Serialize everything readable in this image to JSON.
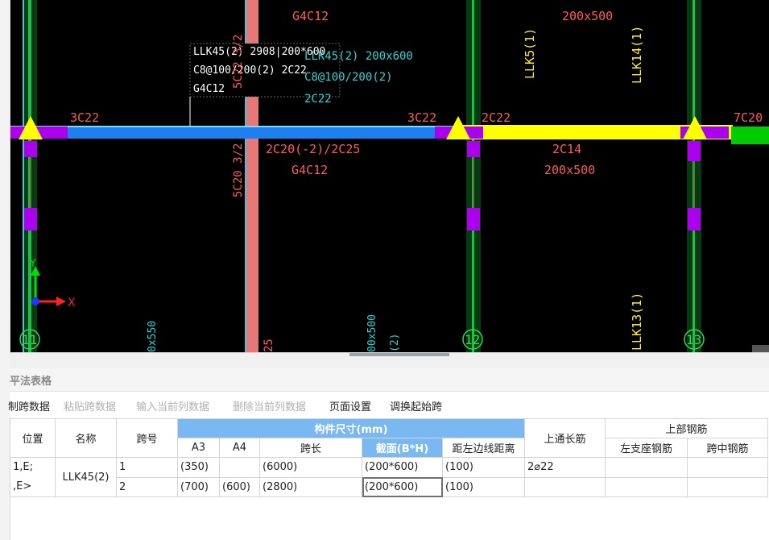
{
  "drawing": {
    "labels": {
      "top_g4c12": "G4C12",
      "top_200x500": "200x500",
      "llk5": "LLK5(1)",
      "llk14": "LLK14(1)",
      "llk13": "LLK13(1)",
      "tip_line1": "LLK45(2) 2908|200*600",
      "tip_line2": "C8@100/200(2) 2C22",
      "tip_line3": "G4C12",
      "cyan_llk": "LLK45(2) 200x600",
      "cyan_c8": "C8@100/200(2)",
      "cyan_2c22": "2C22",
      "left_3c22": "3C22",
      "mid_3c22": "3C22",
      "right_2c22": "2C22",
      "right_7c20": "7C20",
      "below_2c20": "2C20(-2)/2C25",
      "below_g4c12": "G4C12",
      "below_2c14": "2C14",
      "below_200x500": "200x500",
      "vert_5c20": "5C20 3/2",
      "vert_5c22": "5C22 3/2",
      "bottom_x550": "0x550",
      "bottom_25": "25",
      "bottom_00x500": "00x500",
      "bottom_2": "(2)",
      "axis_y": "Y",
      "axis_x": "X",
      "grid_11": "11",
      "grid_12": "12",
      "grid_13": "13"
    },
    "colors": {
      "background": "#000000",
      "red_text": "#ff5a5a",
      "cyan_text": "#2ad6d6",
      "yellow": "#ffff00",
      "beam_blue": "#1e7ff0",
      "magenta": "#aa00ee",
      "pink_col": "#e87878",
      "green": "#00cc00"
    }
  },
  "panel": {
    "title": "平法表格",
    "toolbar": {
      "copy": "制跨数据",
      "paste": "粘贴跨数据",
      "input_col": "输入当前列数据",
      "delete_col": "删除当前列数据",
      "page_setup": "页面设置",
      "swap_start": "调换起始跨"
    }
  },
  "table": {
    "headers": {
      "position": "位置",
      "name": "名称",
      "span_no": "跨号",
      "size_group": "构件尺寸(mm)",
      "a3": "A3",
      "a4": "A4",
      "span_len": "跨长",
      "section": "截面(B*H)",
      "dist": "距左边线距离",
      "top_long": "上通长筋",
      "top_rebar_group": "上部钢筋",
      "left_seat": "左支座钢筋",
      "mid_span": "跨中钢筋"
    },
    "position_line1": "1,E;",
    "position_line2": ",E>",
    "name": "LLK45(2)",
    "rows": [
      {
        "span": "1",
        "a3": "(350)",
        "a4": "",
        "len": "(6000)",
        "section": "(200*600)",
        "dist": "(100)",
        "top_long": "2⌀22",
        "left_seat": "",
        "mid_span": ""
      },
      {
        "span": "2",
        "a3": "(700)",
        "a4": "(600)",
        "len": "(2800)",
        "section": "(200*600)",
        "dist": "(100)",
        "top_long": "",
        "left_seat": "",
        "mid_span": ""
      }
    ]
  }
}
